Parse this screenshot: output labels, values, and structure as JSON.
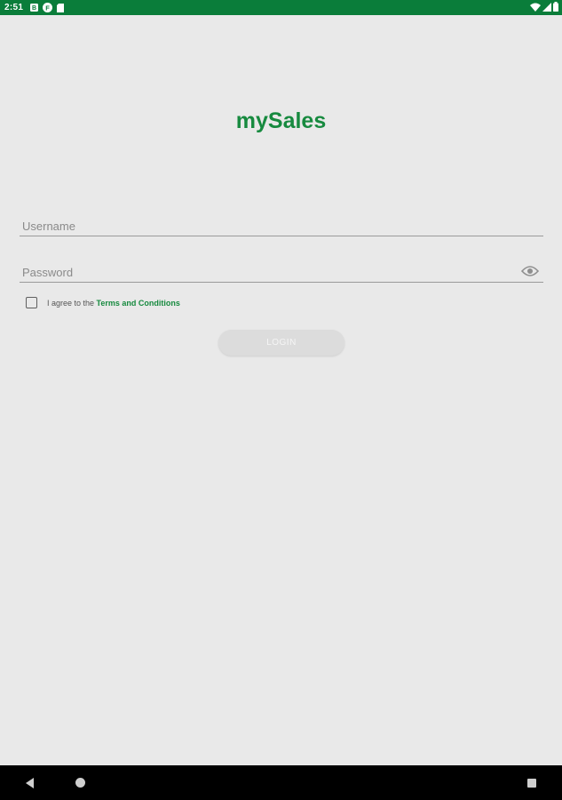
{
  "status_bar": {
    "time": "2:51",
    "left_icons": [
      "notification-b-icon",
      "notification-f-icon",
      "sim-card-icon"
    ],
    "right_icons": [
      "wifi-icon",
      "signal-icon",
      "battery-icon"
    ],
    "color": "#0a7d3a"
  },
  "app": {
    "title": "mySales",
    "brand_color": "#178a3f"
  },
  "form": {
    "username": {
      "placeholder": "Username",
      "value": ""
    },
    "password": {
      "placeholder": "Password",
      "value": "",
      "toggle_icon": "eye-icon"
    },
    "terms": {
      "checked": false,
      "prefix": "I agree to the ",
      "link_text": "Terms and Conditions"
    },
    "login_label": "LOGIN",
    "login_enabled": false
  },
  "nav_bar": {
    "icons": [
      "back-icon",
      "home-icon",
      "recents-icon"
    ]
  }
}
